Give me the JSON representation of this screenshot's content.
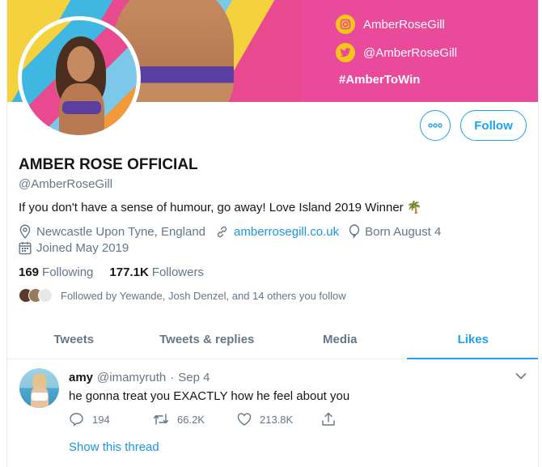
{
  "banner": {
    "instagram_handle": "AmberRoseGill",
    "twitter_handle": "@AmberRoseGill",
    "hashtag": "#AmberToWin",
    "pink_color": "#e94a9b",
    "icon_color": "#f5c518"
  },
  "profile": {
    "name": "AMBER ROSE OFFICIAL",
    "handle": "@AmberRoseGill",
    "bio": "If you don't have a sense of humour, go away!  Love Island 2019 Winner 🌴",
    "location": "Newcastle Upon Tyne, England",
    "website": "amberrosegill.co.uk",
    "birthday": "Born August 4",
    "joined": "Joined May 2019",
    "following_count": "169",
    "following_label": "Following",
    "followers_count": "177.1K",
    "followers_label": "Followers",
    "followed_by": "Followed by Yewande, Josh Denzel, and 14 others you follow"
  },
  "buttons": {
    "more_icon": "more-icon",
    "follow_label": "Follow"
  },
  "tabs": [
    {
      "label": "Tweets",
      "active": false
    },
    {
      "label": "Tweets & replies",
      "active": false
    },
    {
      "label": "Media",
      "active": false
    },
    {
      "label": "Likes",
      "active": true
    }
  ],
  "tweet": {
    "author": "amy",
    "handle": "@imamyruth",
    "separator": "·",
    "date": "Sep 4",
    "text": "he gonna treat you EXACTLY how he feel about you",
    "replies": "194",
    "retweets": "66.2K",
    "likes": "213.8K",
    "show_thread": "Show this thread"
  },
  "colors": {
    "accent": "#1da1f2",
    "link": "#1b95e0",
    "muted": "#657786",
    "text": "#14171a"
  }
}
